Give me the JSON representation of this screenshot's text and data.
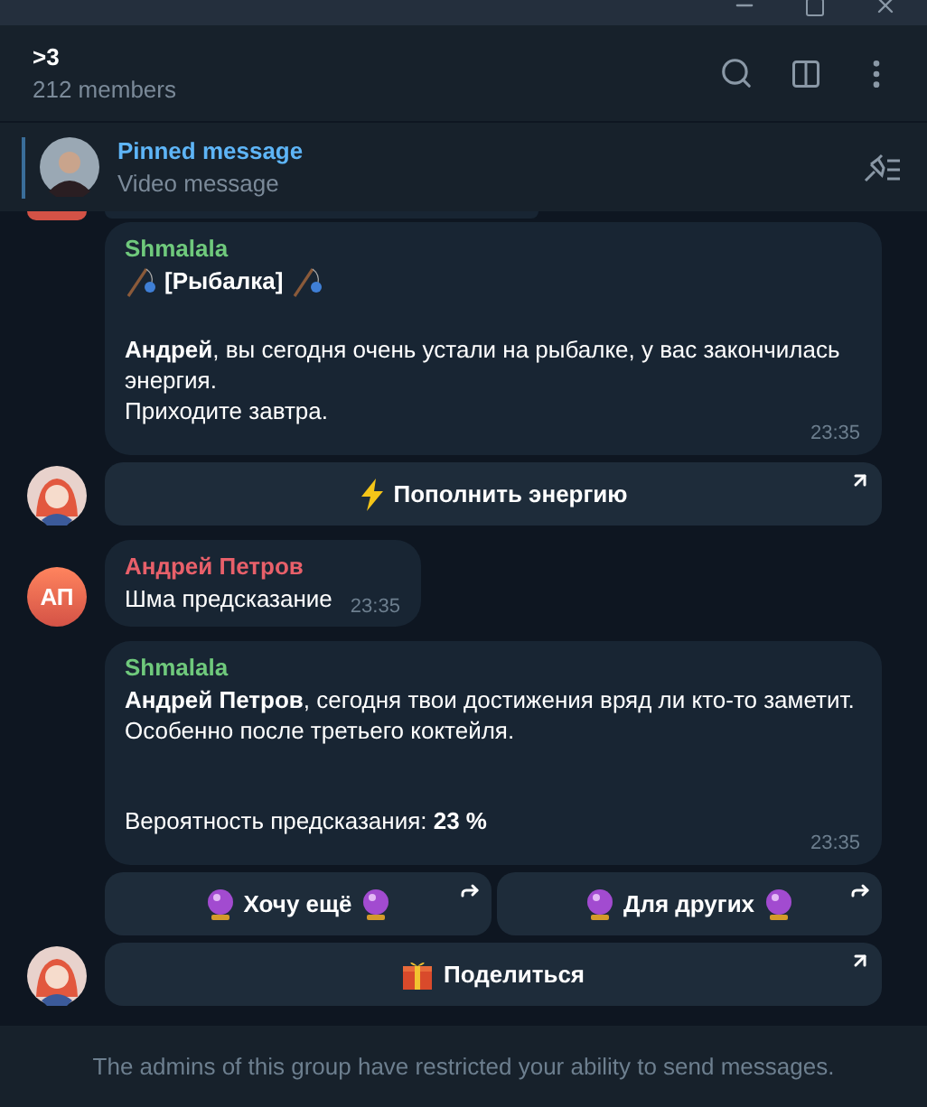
{
  "chat": {
    "title": ">3",
    "subtitle": "212 members"
  },
  "pinned": {
    "title": "Pinned message",
    "text": "Video message"
  },
  "messages": [
    {
      "kind": "bot",
      "author": "Shmalala",
      "heading": "[Рыбалка]",
      "paragraphs": [
        [
          "**Андрей**, вы сегодня очень устали на рыбалке, у вас закончилась энергия.",
          "Приходите завтра."
        ]
      ],
      "time": "23:35",
      "buttons": [
        [
          {
            "label": "Пополнить энергию",
            "kind": "energy"
          }
        ]
      ]
    },
    {
      "kind": "user",
      "author": "Андрей Петров",
      "initials": "АП",
      "paragraphs": [
        [
          "Шма предсказание"
        ]
      ],
      "time": "23:35"
    },
    {
      "kind": "bot",
      "author": "Shmalala",
      "paragraphs": [
        [
          "**Андрей Петров**, сегодня твои достижения вряд ли кто-то заметит. Особенно после третьего коктейля."
        ],
        [
          "Вероятность предсказания: **23 %**"
        ]
      ],
      "time": "23:35",
      "buttons": [
        [
          {
            "label": "Хочу ещё",
            "kind": "crystal"
          },
          {
            "label": "Для других",
            "kind": "crystal"
          }
        ],
        [
          {
            "label": "Поделиться",
            "kind": "gift"
          }
        ]
      ]
    }
  ],
  "footer": "The admins of this group have restricted your ability to send messages."
}
